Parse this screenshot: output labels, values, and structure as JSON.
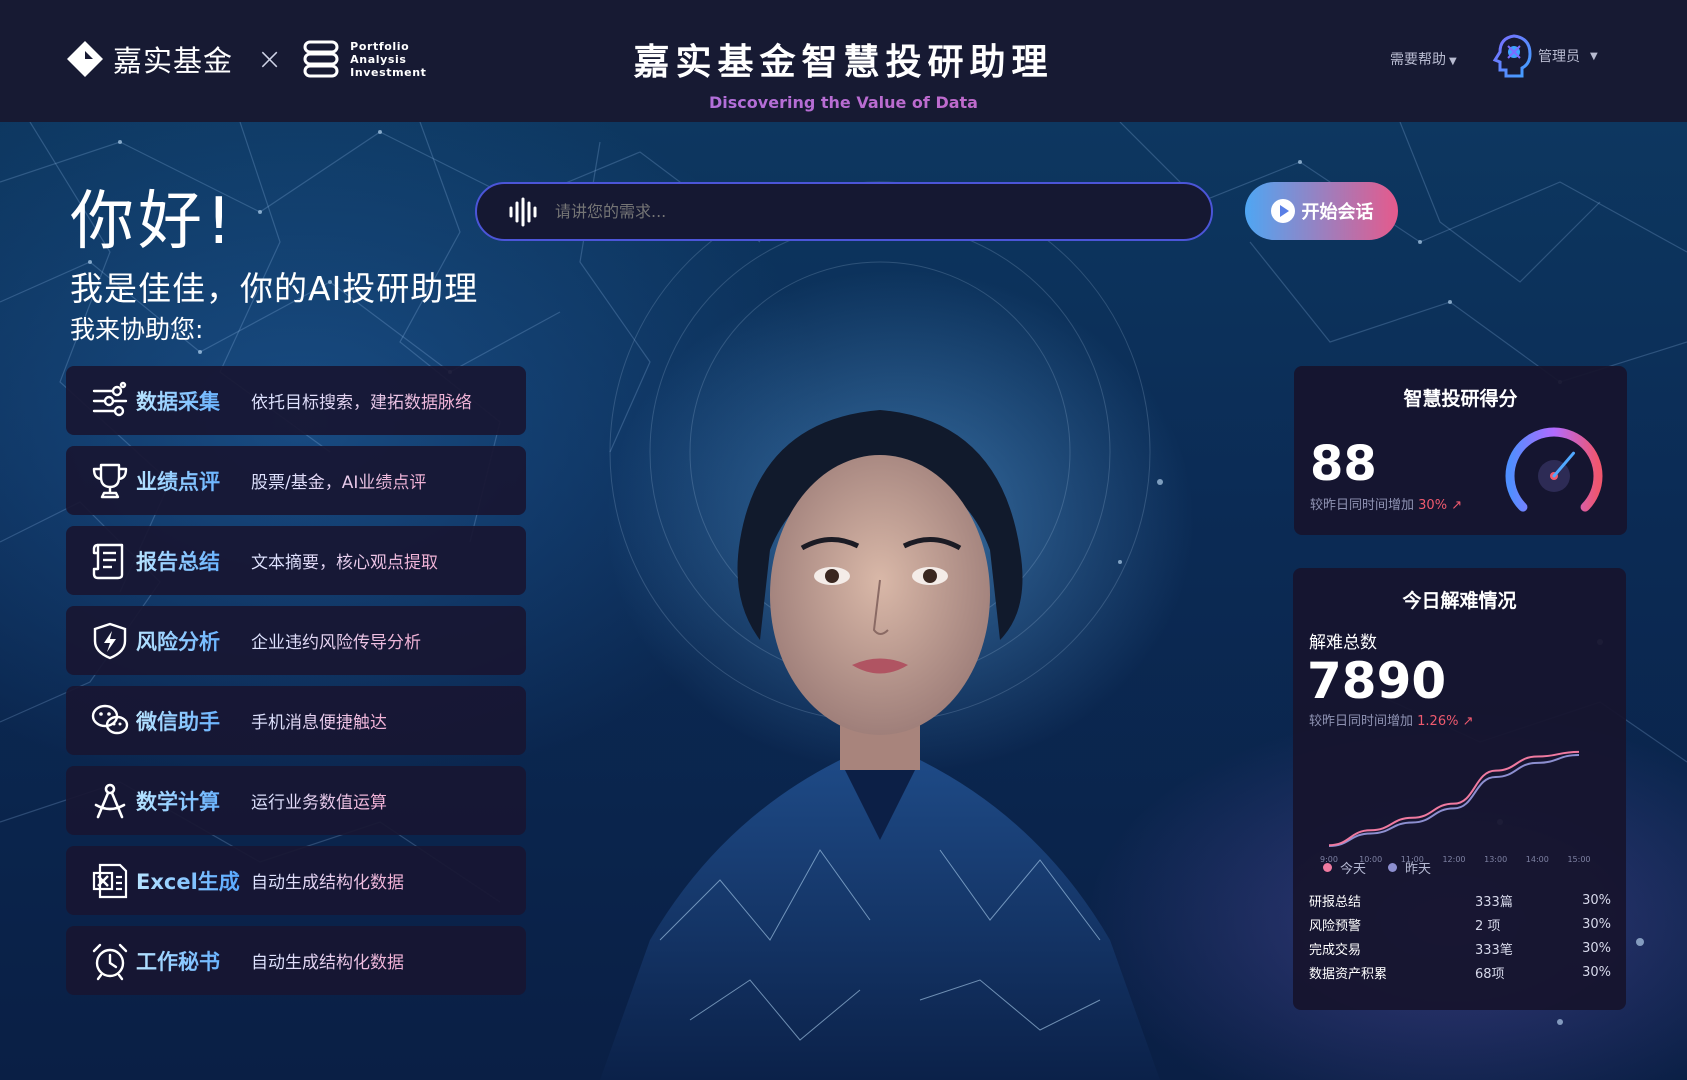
{
  "header": {
    "brand_name": "嘉实基金",
    "brand_separator": "×",
    "partner_line1": "Portfolio",
    "partner_line2": "Analysis",
    "partner_line3": "Investment",
    "title": "嘉实基金智慧投研助理",
    "subtitle": "Discovering the Value of Data",
    "help_label": "需要帮助",
    "admin_label": "管理员"
  },
  "greeting": {
    "hello": "你好!",
    "intro": "我是佳佳，你的AI投研助理",
    "assist": "我来协助您:"
  },
  "search": {
    "placeholder": "请讲您的需求...",
    "start_label": "开始会话"
  },
  "features": [
    {
      "name": "数据采集",
      "desc": "依托目标搜索，建拓数据脉络",
      "icon": "data-collection-icon"
    },
    {
      "name": "业绩点评",
      "desc": "股票/基金，AI业绩点评",
      "icon": "trophy-icon"
    },
    {
      "name": "报告总结",
      "desc": "文本摘要，核心观点提取",
      "icon": "scroll-report-icon"
    },
    {
      "name": "风险分析",
      "desc": "企业违约风险传导分析",
      "icon": "shield-bolt-icon"
    },
    {
      "name": "微信助手",
      "desc": "手机消息便捷触达",
      "icon": "wechat-icon"
    },
    {
      "name": "数学计算",
      "desc": "运行业务数值运算",
      "icon": "compass-icon"
    },
    {
      "name": "Excel生成",
      "desc": "自动生成结构化数据",
      "icon": "excel-icon"
    },
    {
      "name": "工作秘书",
      "desc": "自动生成结构化数据",
      "icon": "alarm-clock-icon"
    }
  ],
  "score": {
    "title": "智慧投研得分",
    "value": "88",
    "note_prefix": "较昨日同时间增加",
    "note_delta": "30%",
    "gauge_fraction": 0.65
  },
  "today": {
    "title": "今日解难情况",
    "total_label": "解难总数",
    "total_value": "7890",
    "note_prefix": "较昨日同时间增加",
    "note_delta": "1.26%",
    "legend_today": "今天",
    "legend_yesterday": "昨天",
    "stats": [
      {
        "name": "研报总结",
        "value": "333篇",
        "pct": "30%"
      },
      {
        "name": "风险预警",
        "value": "2 项",
        "pct": "30%"
      },
      {
        "name": "完成交易",
        "value": "333笔",
        "pct": "30%"
      },
      {
        "name": "数据资产积累",
        "value": "68项",
        "pct": "30%"
      }
    ]
  },
  "colors": {
    "header_bg": "#171a33",
    "accent_blue": "#4ea2ff",
    "accent_pink": "#e55a8c",
    "up_red": "#ef5a6e",
    "series_today": "#f07aa0",
    "series_yesterday": "#8d8fd0"
  },
  "chart_data": {
    "type": "line",
    "x": [
      "9:00",
      "10:00",
      "11:00",
      "12:00",
      "13:00",
      "14:00",
      "15:00"
    ],
    "series": [
      {
        "name": "今天",
        "values": [
          0.5,
          10,
          18,
          27,
          48,
          57,
          60
        ]
      },
      {
        "name": "昨天",
        "values": [
          0,
          8,
          15,
          24,
          44,
          53,
          58
        ]
      }
    ],
    "ylim": [
      0,
      65
    ],
    "grid": false,
    "legend": "bottom-left"
  }
}
